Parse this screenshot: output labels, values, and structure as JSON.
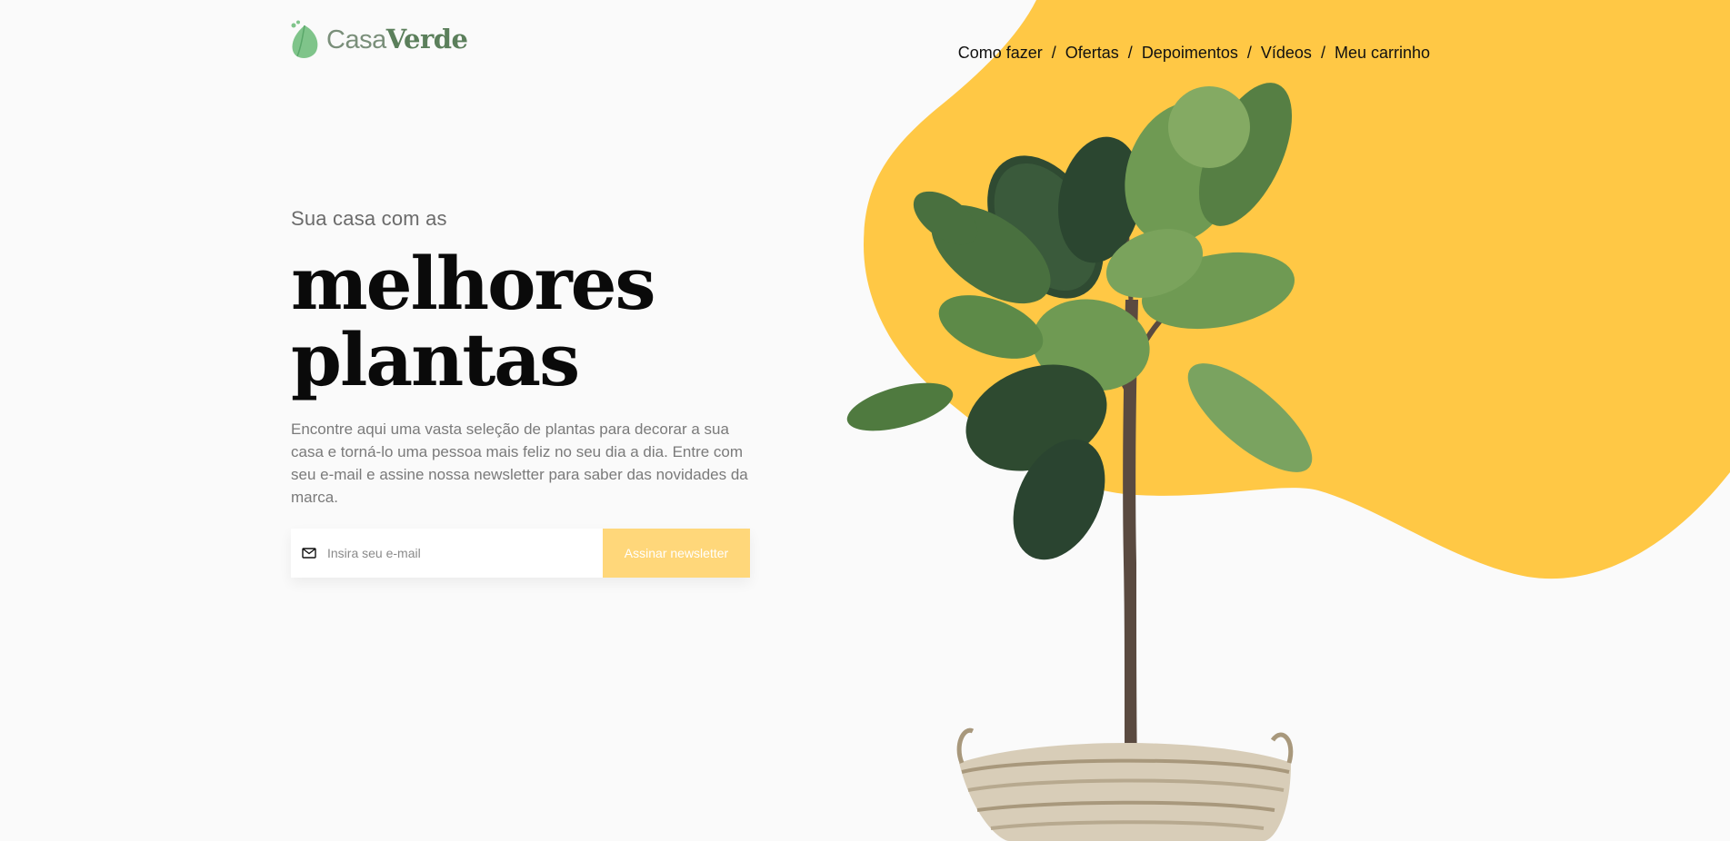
{
  "brand": {
    "name_light": "Casa",
    "name_bold": "Verde",
    "accent_green": "#6fa36f",
    "accent_yellow": "#ffc845"
  },
  "nav": {
    "items": [
      {
        "label": "Como fazer"
      },
      {
        "label": "Ofertas"
      },
      {
        "label": "Depoimentos"
      },
      {
        "label": "Vídeos"
      },
      {
        "label": "Meu carrinho"
      }
    ],
    "separator": "/"
  },
  "hero": {
    "eyebrow": "Sua casa com as",
    "headline_line1": "melhores",
    "headline_line2": "plantas",
    "description": "Encontre aqui uma vasta seleção de plantas para decorar a sua casa e torná-lo uma pessoa mais feliz no seu dia a dia. Entre com seu e-mail e assine nossa newsletter para saber das novidades da marca."
  },
  "newsletter": {
    "email_placeholder": "Insira seu e-mail",
    "email_value": "",
    "button_label": "Assinar newsletter",
    "icon": "mail-icon"
  },
  "images": {
    "hero_plant": "fiddle-leaf-fig-in-basket",
    "background_shape": "yellow-blob"
  }
}
